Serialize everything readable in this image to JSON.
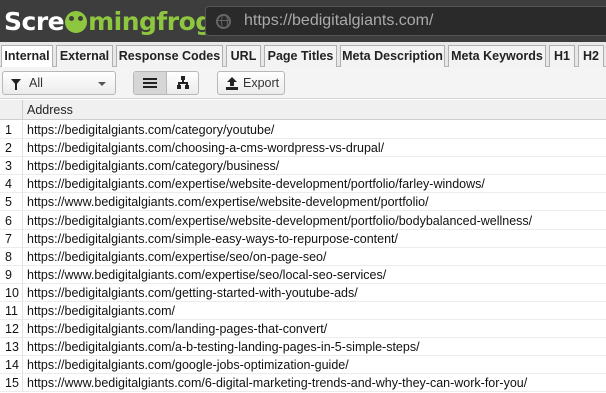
{
  "app": {
    "logo_prefix": "Scre",
    "logo_suffix": "mingfrog",
    "address_bar": "https://bedigitalgiants.com/"
  },
  "tabs": [
    {
      "label": "Internal",
      "active": true
    },
    {
      "label": "External"
    },
    {
      "label": "Response Codes"
    },
    {
      "label": "URL"
    },
    {
      "label": "Page Titles"
    },
    {
      "label": "Meta Description"
    },
    {
      "label": "Meta Keywords"
    },
    {
      "label": "H1"
    },
    {
      "label": "H2"
    }
  ],
  "toolbar": {
    "filter_value": "All",
    "export_label": "Export"
  },
  "table": {
    "column_header": "Address",
    "rows": [
      {
        "n": "1",
        "url": "https://bedigitalgiants.com/category/youtube/"
      },
      {
        "n": "2",
        "url": "https://bedigitalgiants.com/choosing-a-cms-wordpress-vs-drupal/"
      },
      {
        "n": "3",
        "url": "https://bedigitalgiants.com/category/business/"
      },
      {
        "n": "4",
        "url": "https://bedigitalgiants.com/expertise/website-development/portfolio/farley-windows/"
      },
      {
        "n": "5",
        "url": "https://www.bedigitalgiants.com/expertise/website-development/portfolio/"
      },
      {
        "n": "6",
        "url": "https://bedigitalgiants.com/expertise/website-development/portfolio/bodybalanced-wellness/"
      },
      {
        "n": "7",
        "url": "https://bedigitalgiants.com/simple-easy-ways-to-repurpose-content/"
      },
      {
        "n": "8",
        "url": "https://bedigitalgiants.com/expertise/seo/on-page-seo/"
      },
      {
        "n": "9",
        "url": "https://www.bedigitalgiants.com/expertise/seo/local-seo-services/"
      },
      {
        "n": "10",
        "url": "https://bedigitalgiants.com/getting-started-with-youtube-ads/"
      },
      {
        "n": "11",
        "url": "https://bedigitalgiants.com/"
      },
      {
        "n": "12",
        "url": "https://bedigitalgiants.com/landing-pages-that-convert/"
      },
      {
        "n": "13",
        "url": "https://bedigitalgiants.com/a-b-testing-landing-pages-in-5-simple-steps/"
      },
      {
        "n": "14",
        "url": "https://bedigitalgiants.com/google-jobs-optimization-guide/"
      },
      {
        "n": "15",
        "url": "https://www.bedigitalgiants.com/6-digital-marketing-trends-and-why-they-can-work-for-you/"
      }
    ]
  }
}
